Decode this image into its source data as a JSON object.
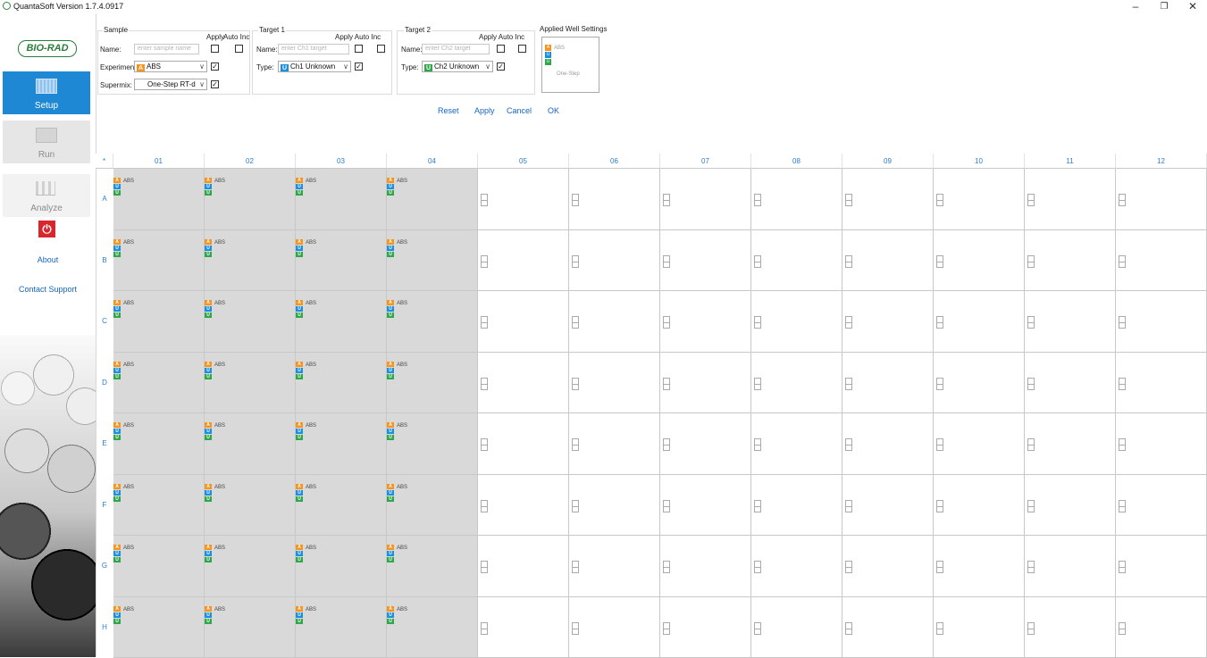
{
  "window": {
    "title": "QuantaSoft Version 1.7.4.0917",
    "minimize": "–",
    "restore": "❐",
    "close": "✕"
  },
  "sidebar": {
    "logo": "BIO-RAD",
    "nav": [
      {
        "label": "Setup",
        "active": true
      },
      {
        "label": "Run"
      },
      {
        "label": "Analyze"
      }
    ],
    "about": "About",
    "contact": "Contact Support",
    "power_icon": "⏻"
  },
  "sample": {
    "title": "Sample",
    "apply_label": "Apply",
    "auto_inc_label": "Auto Inc",
    "name_label": "Name:",
    "name_placeholder": "enter sample name",
    "experiment_label": "Experiment:",
    "experiment_value": "ABS",
    "supermix_label": "Supermix:",
    "supermix_value": "One-Step RT-d"
  },
  "target1": {
    "title": "Target 1",
    "apply_auto_inc": "Apply Auto Inc",
    "name_label": "Name:",
    "name_placeholder": "enter Ch1 target",
    "type_label": "Type:",
    "type_value": "Ch1 Unknown"
  },
  "target2": {
    "title": "Target 2",
    "apply_auto_inc": "Apply Auto Inc",
    "name_label": "Name:",
    "name_placeholder": "enter Ch2 target",
    "type_label": "Type:",
    "type_value": "Ch2 Unknown"
  },
  "applied": {
    "title": "Applied Well Settings",
    "experiment": "ABS",
    "supermix": "One-Step"
  },
  "buttons": {
    "reset": "Reset",
    "apply": "Apply",
    "cancel": "Cancel",
    "ok": "OK"
  },
  "plate": {
    "corner": "*",
    "columns": [
      "01",
      "02",
      "03",
      "04",
      "05",
      "06",
      "07",
      "08",
      "09",
      "10",
      "11",
      "12"
    ],
    "rows": [
      "A",
      "B",
      "C",
      "D",
      "E",
      "F",
      "G",
      "H"
    ],
    "filled_columns": 4,
    "well_label": "ABS",
    "icons": {
      "experiment": "A",
      "ch1": "U",
      "ch2": "U"
    }
  },
  "colors": {
    "accent": "#1e88d4",
    "experiment": "#f7941d",
    "ch1": "#1c8fe0",
    "ch2": "#2ea74a",
    "filled_well": "#d9d9d9"
  }
}
